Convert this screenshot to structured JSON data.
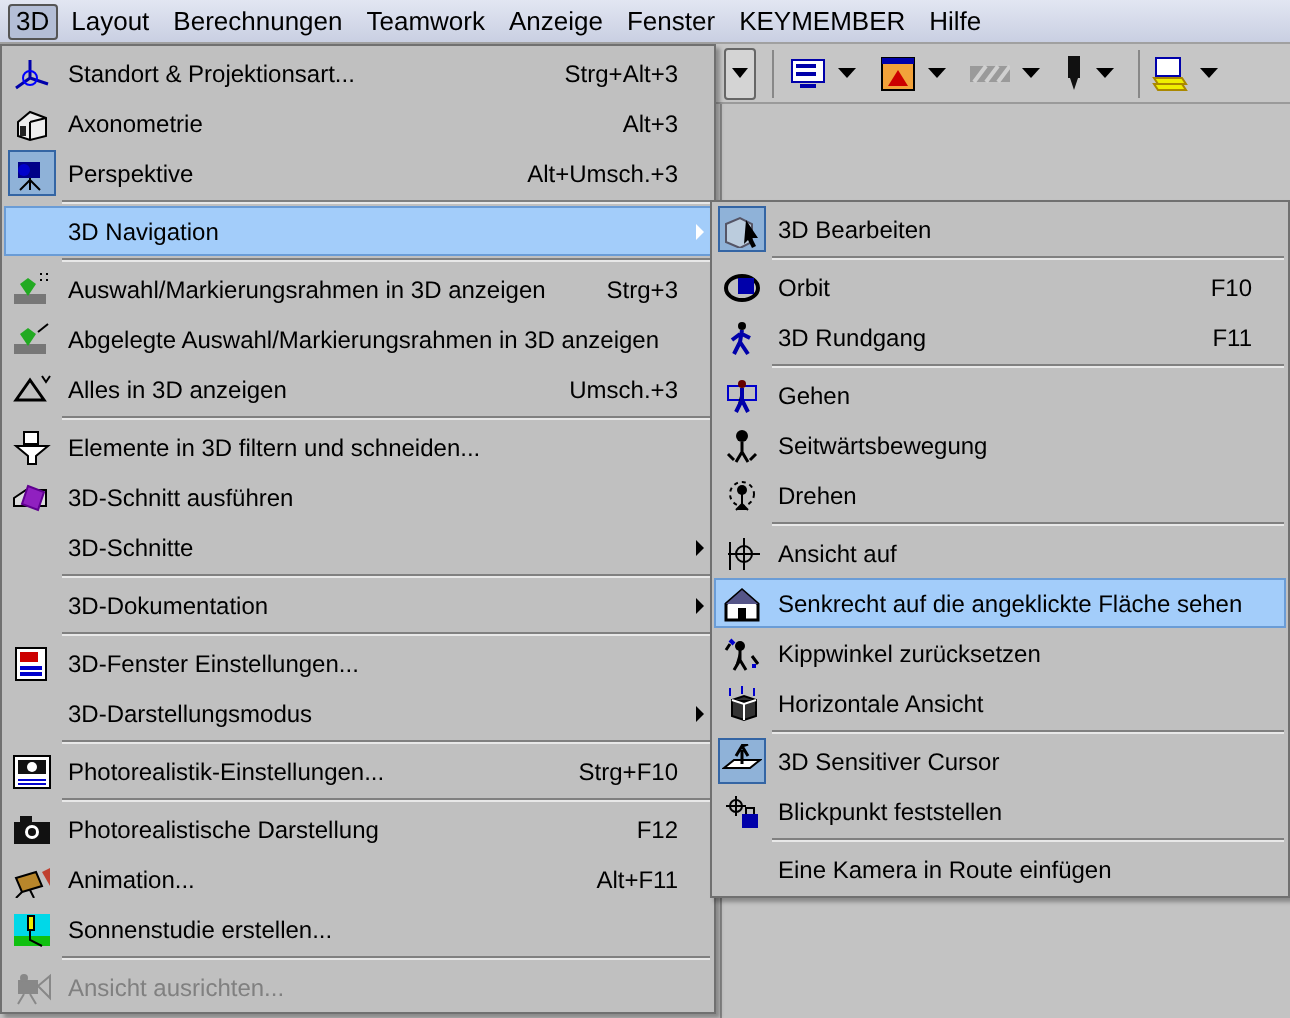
{
  "menu_bar": [
    {
      "label": "3D",
      "selected": true
    },
    {
      "label": "Layout",
      "selected": false
    },
    {
      "label": "Berechnungen",
      "selected": false
    },
    {
      "label": "Teamwork",
      "selected": false
    },
    {
      "label": "Anzeige",
      "selected": false
    },
    {
      "label": "Fenster",
      "selected": false
    },
    {
      "label": "KEYMEMBER",
      "selected": false
    },
    {
      "label": "Hilfe",
      "selected": false
    }
  ],
  "menu": [
    {
      "kind": "item",
      "label": "Standort & Projektionsart...",
      "shortcut": "Strg+Alt+3",
      "checked": false,
      "selected": false,
      "submenu": false,
      "disabled": false
    },
    {
      "kind": "item",
      "label": "Axonometrie",
      "shortcut": "Alt+3",
      "checked": false,
      "selected": false,
      "submenu": false,
      "disabled": false
    },
    {
      "kind": "item",
      "label": "Perspektive",
      "shortcut": "Alt+Umsch.+3",
      "checked": true,
      "selected": false,
      "submenu": false,
      "disabled": false
    },
    {
      "kind": "separator"
    },
    {
      "kind": "item",
      "label": "3D Navigation",
      "checked": false,
      "selected": true,
      "submenu": true,
      "disabled": false
    },
    {
      "kind": "separator"
    },
    {
      "kind": "item",
      "label": "Auswahl/Markierungsrahmen in 3D anzeigen",
      "shortcut": "Strg+3",
      "checked": false,
      "selected": false,
      "submenu": false,
      "disabled": false
    },
    {
      "kind": "item",
      "label": "Abgelegte Auswahl/Markierungsrahmen in 3D anzeigen",
      "checked": false,
      "selected": false,
      "submenu": false,
      "disabled": false
    },
    {
      "kind": "item",
      "label": "Alles in 3D anzeigen",
      "shortcut": "Umsch.+3",
      "checked": false,
      "selected": false,
      "submenu": false,
      "disabled": false
    },
    {
      "kind": "separator"
    },
    {
      "kind": "item",
      "label": "Elemente in 3D filtern und schneiden...",
      "checked": false,
      "selected": false,
      "submenu": false,
      "disabled": false
    },
    {
      "kind": "item",
      "label": "3D-Schnitt ausführen",
      "checked": false,
      "selected": false,
      "submenu": false,
      "disabled": false
    },
    {
      "kind": "item",
      "label": "3D-Schnitte",
      "checked": false,
      "selected": false,
      "submenu": true,
      "disabled": false
    },
    {
      "kind": "separator"
    },
    {
      "kind": "item",
      "label": "3D-Dokumentation",
      "checked": false,
      "selected": false,
      "submenu": true,
      "disabled": false
    },
    {
      "kind": "separator"
    },
    {
      "kind": "item",
      "label": "3D-Fenster Einstellungen...",
      "checked": false,
      "selected": false,
      "submenu": false,
      "disabled": false
    },
    {
      "kind": "item",
      "label": "3D-Darstellungsmodus",
      "checked": false,
      "selected": false,
      "submenu": true,
      "disabled": false
    },
    {
      "kind": "separator"
    },
    {
      "kind": "item",
      "label": "Photorealistik-Einstellungen...",
      "shortcut": "Strg+F10",
      "checked": false,
      "selected": false,
      "submenu": false,
      "disabled": false
    },
    {
      "kind": "separator"
    },
    {
      "kind": "item",
      "label": "Photorealistische Darstellung",
      "shortcut": "F12",
      "checked": false,
      "selected": false,
      "submenu": false,
      "disabled": false
    },
    {
      "kind": "item",
      "label": "Animation...",
      "shortcut": "Alt+F11",
      "checked": false,
      "selected": false,
      "submenu": false,
      "disabled": false
    },
    {
      "kind": "item",
      "label": "Sonnenstudie erstellen...",
      "checked": false,
      "selected": false,
      "submenu": false,
      "disabled": false
    },
    {
      "kind": "separator"
    },
    {
      "kind": "item",
      "label": "Ansicht ausrichten...",
      "checked": false,
      "selected": false,
      "submenu": false,
      "disabled": true
    }
  ],
  "submenu": [
    {
      "kind": "item",
      "label": "3D Bearbeiten",
      "checked": true,
      "selected": false
    },
    {
      "kind": "separator"
    },
    {
      "kind": "item",
      "label": "Orbit",
      "shortcut": "F10",
      "checked": false,
      "selected": false
    },
    {
      "kind": "item",
      "label": "3D Rundgang",
      "shortcut": "F11",
      "checked": false,
      "selected": false
    },
    {
      "kind": "separator"
    },
    {
      "kind": "item",
      "label": "Gehen",
      "checked": false,
      "selected": false
    },
    {
      "kind": "item",
      "label": "Seitwärtsbewegung",
      "checked": false,
      "selected": false
    },
    {
      "kind": "item",
      "label": "Drehen",
      "checked": false,
      "selected": false
    },
    {
      "kind": "separator"
    },
    {
      "kind": "item",
      "label": "Ansicht auf",
      "checked": false,
      "selected": false
    },
    {
      "kind": "item",
      "label": "Senkrecht auf die angeklickte Fläche sehen",
      "checked": false,
      "selected": true
    },
    {
      "kind": "item",
      "label": "Kippwinkel zurücksetzen",
      "checked": false,
      "selected": false
    },
    {
      "kind": "item",
      "label": "Horizontale Ansicht",
      "checked": false,
      "selected": false
    },
    {
      "kind": "separator"
    },
    {
      "kind": "item",
      "label": "3D Sensitiver Cursor",
      "checked": true,
      "selected": false
    },
    {
      "kind": "item",
      "label": "Blickpunkt feststellen",
      "checked": false,
      "selected": false
    },
    {
      "kind": "separator"
    },
    {
      "kind": "item",
      "label": "Eine Kamera in Route einfügen",
      "checked": false,
      "selected": false
    }
  ]
}
